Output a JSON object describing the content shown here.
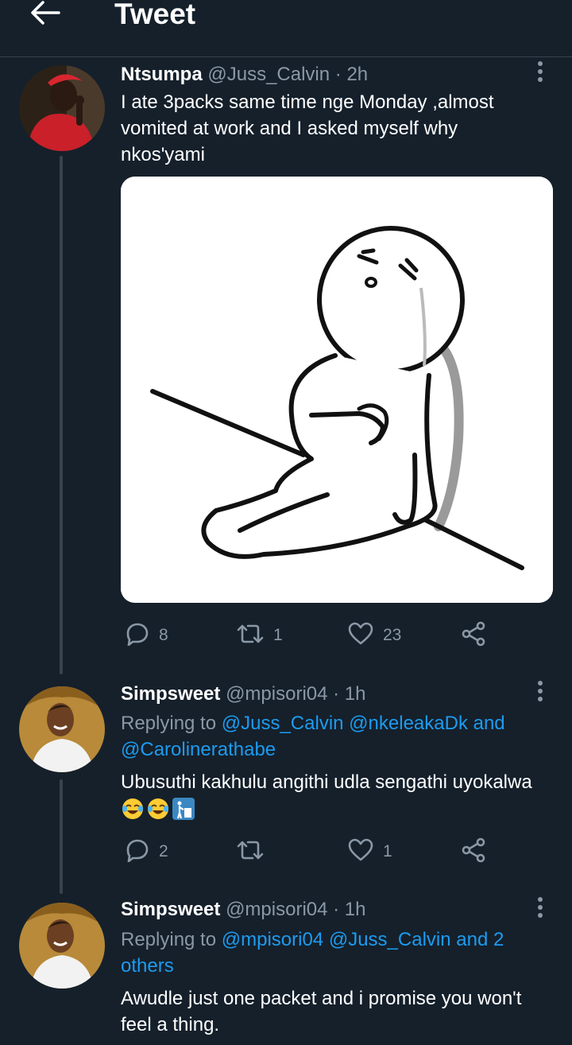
{
  "header": {
    "title": "Tweet",
    "back_icon": "arrow-left-icon"
  },
  "colors": {
    "background": "#15202b",
    "divider": "#38444d",
    "muted": "#8b98a5",
    "link": "#1d9bf0"
  },
  "tweets": [
    {
      "name": "Ntsumpa",
      "handle": "@Juss_Calvin",
      "time": "· 2h",
      "text": "I ate 3packs same time nge Monday ,almost vomited at work and I asked myself why nkos'yami",
      "media": "sticker of a sad cartoon character sitting holding its stomach",
      "actions": {
        "replies": "8",
        "retweets": "1",
        "likes": "23"
      }
    },
    {
      "name": "Simpsweet",
      "handle": "@mpisori04",
      "time": "· 1h",
      "replying_prefix": "Replying to",
      "replying_links": [
        "@Juss_Calvin",
        "@nkeleakaDk and",
        "@Carolinerathabe"
      ],
      "text": "Ubusuthi kakhulu angithi udla sengathi uyokalwa",
      "emojis": [
        "face-with-tears-of-joy-emoji",
        "face-with-tears-of-joy-emoji",
        "put-litter-in-its-place-emoji"
      ],
      "actions": {
        "replies": "2",
        "retweets": "",
        "likes": "1"
      }
    },
    {
      "name": "Simpsweet",
      "handle": "@mpisori04",
      "time": "· 1h",
      "replying_prefix": "Replying to",
      "replying_links": [
        "@mpisori04",
        "@Juss_Calvin and 2",
        "others"
      ],
      "text": "Awudle just one packet and i promise you won't feel a thing."
    }
  ]
}
